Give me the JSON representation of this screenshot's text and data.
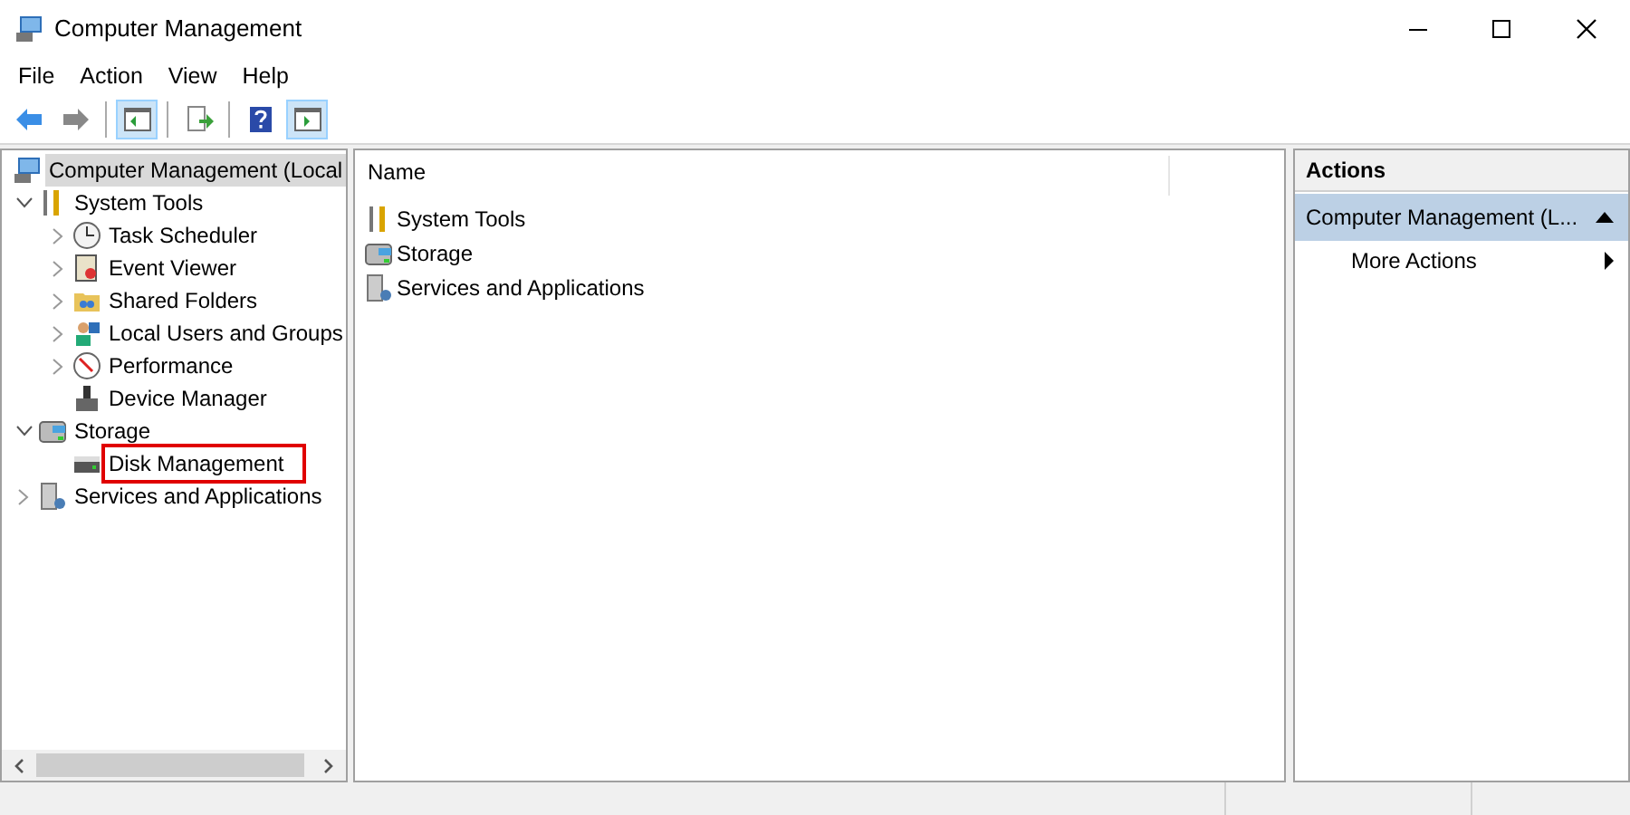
{
  "window": {
    "title": "Computer Management"
  },
  "menu": [
    "File",
    "Action",
    "View",
    "Help"
  ],
  "toolbar": [
    {
      "kind": "back",
      "selected": false
    },
    {
      "kind": "forward",
      "selected": false
    },
    {
      "kind": "tree",
      "selected": true
    },
    {
      "kind": "export",
      "selected": false
    },
    {
      "kind": "help",
      "selected": false
    },
    {
      "kind": "actions",
      "selected": true
    }
  ],
  "tree": [
    {
      "label": "Computer Management (Local",
      "selected": true,
      "highlighted": false,
      "children": [
        {
          "label": "System Tools",
          "expanded": true,
          "selected": false,
          "highlighted": false,
          "children": [
            {
              "label": "Task Scheduler",
              "expanded": false,
              "selected": false,
              "highlighted": false
            },
            {
              "label": "Event Viewer",
              "expanded": false,
              "selected": false,
              "highlighted": false
            },
            {
              "label": "Shared Folders",
              "expanded": false,
              "selected": false,
              "highlighted": false
            },
            {
              "label": "Local Users and Groups",
              "expanded": false,
              "selected": false,
              "highlighted": false
            },
            {
              "label": "Performance",
              "expanded": false,
              "selected": false,
              "highlighted": false
            },
            {
              "label": "Device Manager",
              "selected": false,
              "highlighted": false
            }
          ]
        },
        {
          "label": "Storage",
          "expanded": true,
          "selected": false,
          "highlighted": false,
          "children": [
            {
              "label": "Disk Management",
              "selected": false,
              "highlighted": true
            }
          ]
        },
        {
          "label": "Services and Applications",
          "expanded": false,
          "selected": false,
          "highlighted": false
        }
      ]
    }
  ],
  "list": {
    "columns": [
      "Name"
    ],
    "rows": [
      "System Tools",
      "Storage",
      "Services and Applications"
    ]
  },
  "actions": {
    "title": "Actions",
    "section": "Computer Management (L...",
    "items": [
      "More Actions"
    ]
  }
}
